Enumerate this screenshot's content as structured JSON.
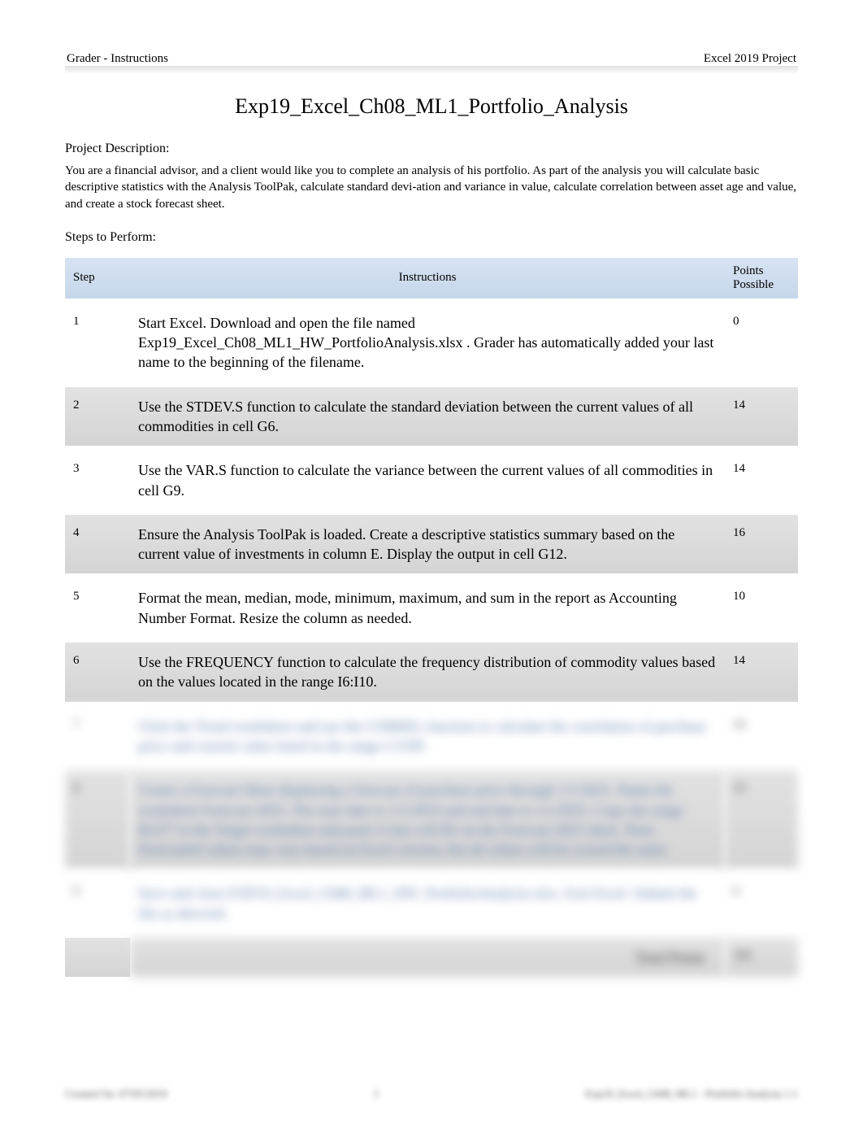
{
  "header": {
    "left": "Grader - Instructions",
    "right": "Excel 2019 Project"
  },
  "title": "Exp19_Excel_Ch08_ML1_Portfolio_Analysis",
  "project_description": {
    "label": "Project Description:",
    "text": "You are a financial advisor, and a client would like you to complete an analysis of his portfolio. As part of the analysis you will calculate basic descriptive statistics with the Analysis ToolPak, calculate standard devi-ation and variance in value, calculate correlation between asset age and value, and create a stock forecast sheet."
  },
  "steps_label": "Steps to Perform:",
  "table_headers": {
    "step": "Step",
    "instructions": "Instructions",
    "points": "Points Possible"
  },
  "steps": [
    {
      "num": "1",
      "instr": "Start Excel. Download and open the file named Exp19_Excel_Ch08_ML1_HW_PortfolioAnalysis.xlsx    . Grader has automatically added your last name to the beginning of the filename.",
      "pts": "0",
      "row": "odd"
    },
    {
      "num": "2",
      "instr": "Use the STDEV.S function to calculate the standard deviation between the current values of all commodities in cell G6.",
      "pts": "14",
      "row": "even"
    },
    {
      "num": "3",
      "instr": "Use the VAR.S function to calculate the variance between the current values of all commodities in cell G9.",
      "pts": "14",
      "row": "odd"
    },
    {
      "num": "4",
      "instr": "Ensure the Analysis ToolPak is loaded. Create a descriptive statistics summary based on the current value of investments in column E. Display the output in cell G12.",
      "pts": "16",
      "row": "even"
    },
    {
      "num": "5",
      "instr": "Format the mean, median, mode, minimum, maximum, and sum in the report as Accounting Number Format. Resize the column as needed.",
      "pts": "10",
      "row": "odd"
    },
    {
      "num": "6",
      "instr": "Use the FREQUENCY function to calculate the frequency distribution of commodity values based on the values located in the range I6:I10.",
      "pts": "14",
      "row": "even"
    }
  ],
  "blurred_rows": [
    {
      "num": "7",
      "instr": "Click the Trend worksheet and use the CORREL function to calculate the correlation of purchase price and current value listed in the range C3:D9.",
      "pts": "16",
      "row": "odd"
    },
    {
      "num": "8",
      "instr": "Create a Forecast Sheet displaying a forecast of purchase price through 1/1/2025. Name the worksheet Forecast 2025. The start date is 1/1/2019 and end date is 1/1/2025. Copy the range B2:F7 to the Target worksheet and paste it into cell B2 on the Forecast 2025 sheet. Note: Forecasted values may vary based on Excel version, but all values will be scored the same.",
      "pts": "16",
      "row": "even"
    },
    {
      "num": "9",
      "instr": "Save and close EXP19_Excel_Ch08_ML1_HW_PortfolioAnalysis.xlsx. Exit Excel. Submit the file as directed.",
      "pts": "0",
      "row": "odd"
    }
  ],
  "totals": {
    "label": "Total Points",
    "value": "100"
  },
  "footer": {
    "left": "Created On: 07/05/2019",
    "center": "1",
    "right": "Exp19_Excel_Ch08_ML1 - Portfolio Analysis 1.1"
  }
}
